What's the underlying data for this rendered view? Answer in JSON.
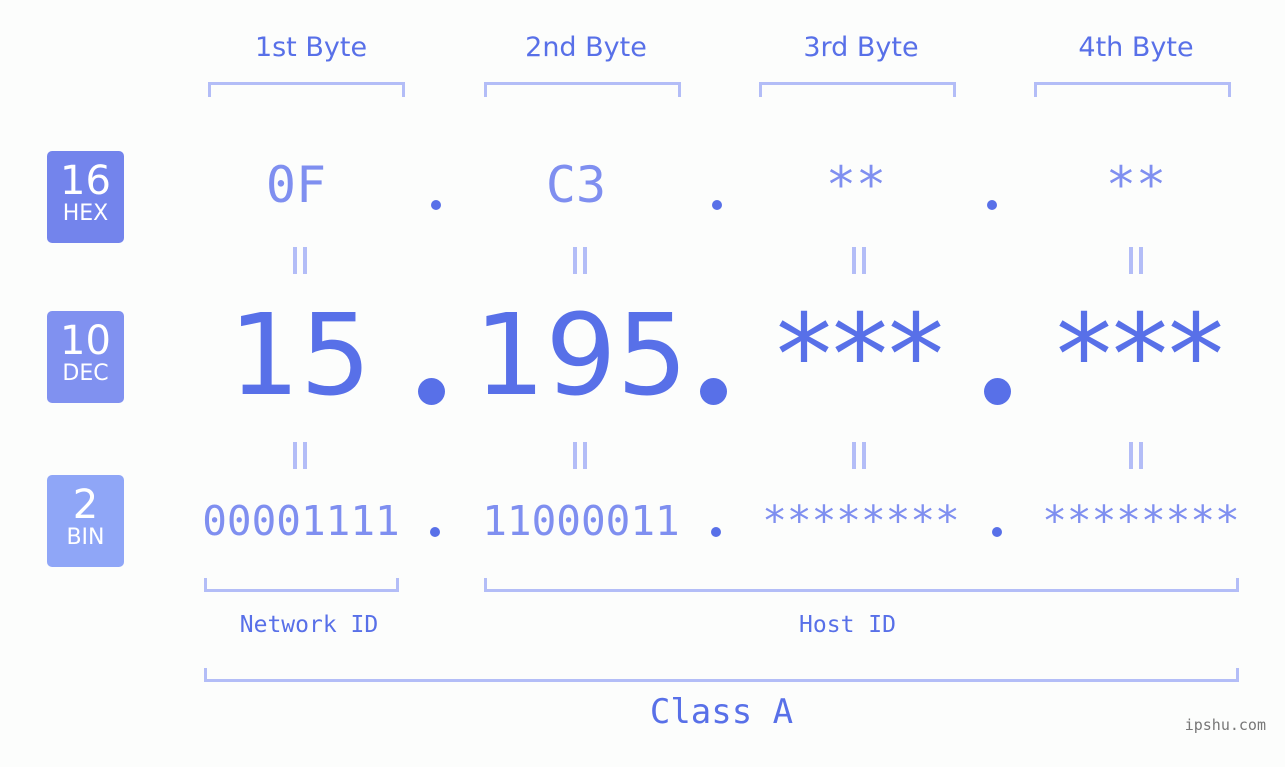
{
  "byte_headers": [
    "1st Byte",
    "2nd Byte",
    "3rd Byte",
    "4th Byte"
  ],
  "badges": {
    "hex": {
      "number": "16",
      "label": "HEX",
      "color": "#7384ec"
    },
    "dec": {
      "number": "10",
      "label": "DEC",
      "color": "#8091f0"
    },
    "bin": {
      "number": "2",
      "label": "BIN",
      "color": "#8fa6f7"
    }
  },
  "hex_values": [
    "0F",
    "C3",
    "**",
    "**"
  ],
  "dec_values": [
    "15",
    "195",
    "***",
    "***"
  ],
  "bin_values": [
    "00001111",
    "11000011",
    "********",
    "********"
  ],
  "labels": {
    "network_id": "Network ID",
    "host_id": "Host ID",
    "class": "Class A"
  },
  "colors": {
    "primary": "#5870e8",
    "secondary": "#7f8ff0",
    "bracket": "#b3bdf7"
  },
  "watermark": "ipshu.com"
}
